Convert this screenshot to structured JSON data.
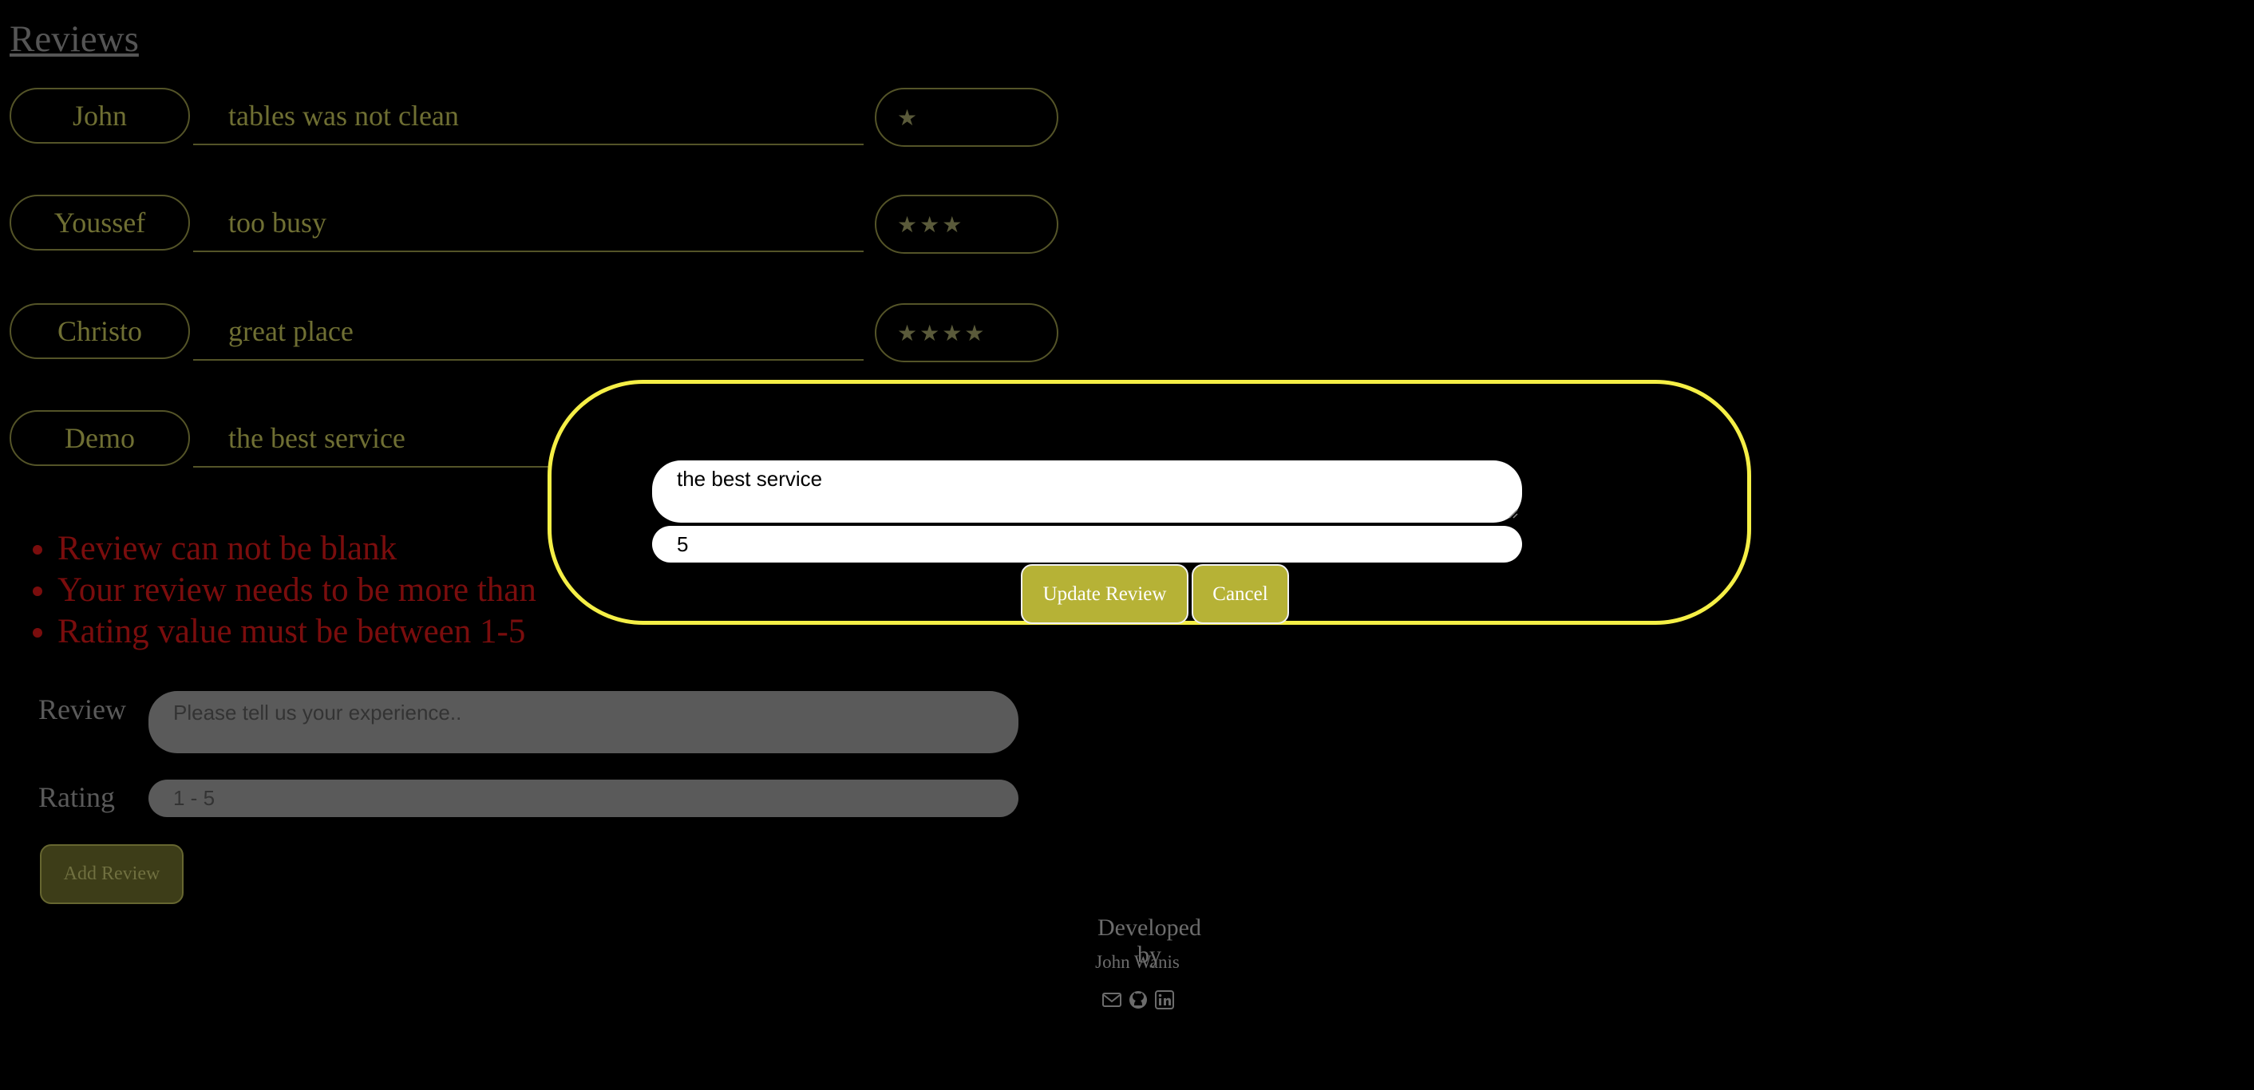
{
  "page": {
    "title": "Reviews"
  },
  "reviews": [
    {
      "name": "John",
      "text": "tables was not clean",
      "rating": 1
    },
    {
      "name": "Youssef",
      "text": "too busy",
      "rating": 3
    },
    {
      "name": "Christo",
      "text": "great place",
      "rating": 4
    },
    {
      "name": "Demo",
      "text": "the best service",
      "rating": 5
    }
  ],
  "errors": [
    "Review can not be blank",
    "Your review needs to be more than",
    "Rating value must be between 1-5"
  ],
  "form": {
    "review_label": "Review",
    "review_placeholder": "Please tell us your experience..",
    "rating_label": "Rating",
    "rating_placeholder": "1 - 5",
    "add_button": "Add Review"
  },
  "footer": {
    "label": "Developed by",
    "author": "John Wanis",
    "icons": [
      "email-icon",
      "github-icon",
      "linkedin-icon"
    ]
  },
  "modal": {
    "review_value": "the best service",
    "rating_value": "5",
    "update_button": "Update Review",
    "cancel_button": "Cancel"
  },
  "colors": {
    "modal_border": "#f5ef46",
    "button_yellow": "#b6b236",
    "error_red": "#7a0d0d"
  }
}
